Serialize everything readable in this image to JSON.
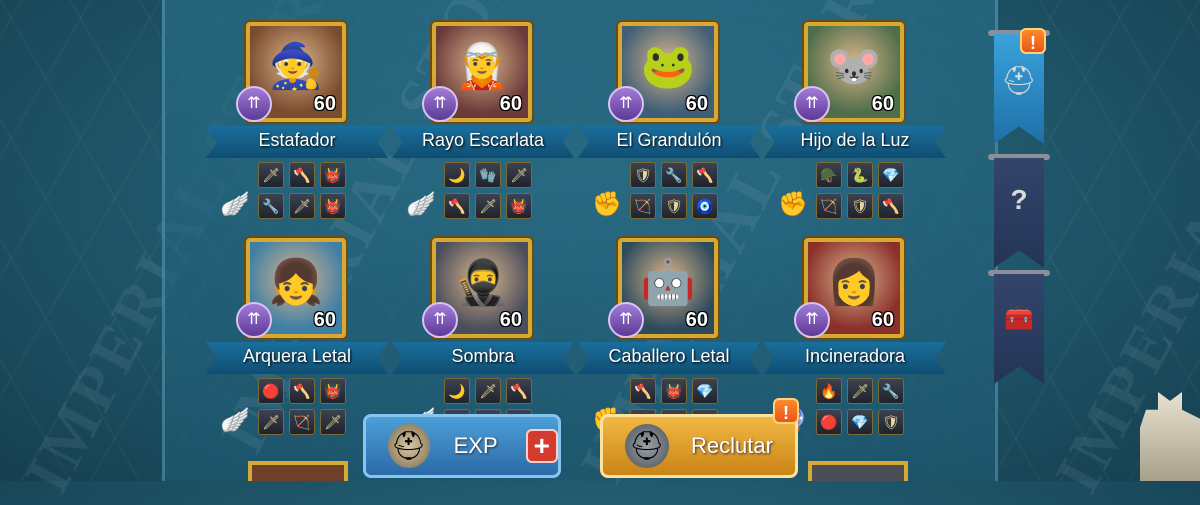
{
  "watermark_text": "IMPERIAL STORE",
  "colors": {
    "frame_gold": "#d6a932",
    "ribbon_blue": "#1a6f9c",
    "rank_purple": "#7a52b8",
    "exp_button": "#3d86c4",
    "recruit_button": "#e2a12d",
    "alert_orange": "#f0702a"
  },
  "heroes": [
    {
      "name": "Estafador",
      "level": "60",
      "rank_icon": "double-arrow-up-icon",
      "trait_icon": "wing-icon",
      "face": "🧙",
      "bg": "#7a4b2e",
      "gear": [
        "🗡",
        "🪓",
        "👹",
        "🔧",
        "🗡",
        "👹"
      ]
    },
    {
      "name": "Rayo Escarlata",
      "level": "60",
      "rank_icon": "double-arrow-up-icon",
      "trait_icon": "wing-icon",
      "face": "🧝",
      "bg": "#6b3b3a",
      "gear": [
        "🌙",
        "🧤",
        "🗡",
        "🪓",
        "🗡",
        "👹"
      ]
    },
    {
      "name": "El Grandulón",
      "level": "60",
      "rank_icon": "double-arrow-up-icon",
      "trait_icon": "fist-icon",
      "face": "🐸",
      "bg": "#3e5f77",
      "gear": [
        "🛡",
        "🔧",
        "🪓",
        "🏹",
        "🛡",
        "🧿"
      ]
    },
    {
      "name": "Hijo de la Luz",
      "level": "60",
      "rank_icon": "double-arrow-up-icon",
      "trait_icon": "fist-icon",
      "face": "🐭",
      "bg": "#4e6e4a",
      "gear": [
        "🪖",
        "🐍",
        "💎",
        "🏹",
        "🛡",
        "🪓"
      ]
    },
    {
      "name": "Arquera Letal",
      "level": "60",
      "rank_icon": "double-arrow-up-icon",
      "trait_icon": "wing-icon",
      "face": "👧",
      "bg": "#3f7fa6",
      "gear": [
        "🔴",
        "🪓",
        "👹",
        "🗡",
        "🏹",
        "🗡"
      ]
    },
    {
      "name": "Sombra",
      "level": "60",
      "rank_icon": "double-arrow-up-icon",
      "trait_icon": "wing-icon",
      "face": "🥷",
      "bg": "#4a4e5c",
      "gear": [
        "🌙",
        "🗡",
        "🪓",
        "🔧",
        "🗡",
        "👹"
      ]
    },
    {
      "name": "Caballero Letal",
      "level": "60",
      "rank_icon": "double-arrow-up-icon",
      "trait_icon": "fist-icon",
      "face": "🤖",
      "bg": "#2e4b5c",
      "gear": [
        "🪓",
        "👹",
        "💎",
        "🛡",
        "🗡",
        "🛡"
      ]
    },
    {
      "name": "Incineradora",
      "level": "60",
      "rank_icon": "double-arrow-up-icon",
      "trait_icon": "orb-icon",
      "face": "👩",
      "bg": "#8a2f2a",
      "gear": [
        "🔥",
        "🗡",
        "🔧",
        "🔴",
        "💎",
        "🛡"
      ]
    }
  ],
  "buttons": {
    "exp_label": "EXP",
    "plus_label": "+",
    "recruit_label": "Reclutar"
  },
  "sidebar": {
    "tabs": [
      {
        "icon": "helmet-icon",
        "glyph": "⛑",
        "alert": "!"
      },
      {
        "icon": "question-helmet-icon",
        "glyph": "?",
        "alert": ""
      },
      {
        "icon": "chest-icon",
        "glyph": "🧰",
        "alert": ""
      }
    ]
  },
  "recruit_alert": "!"
}
